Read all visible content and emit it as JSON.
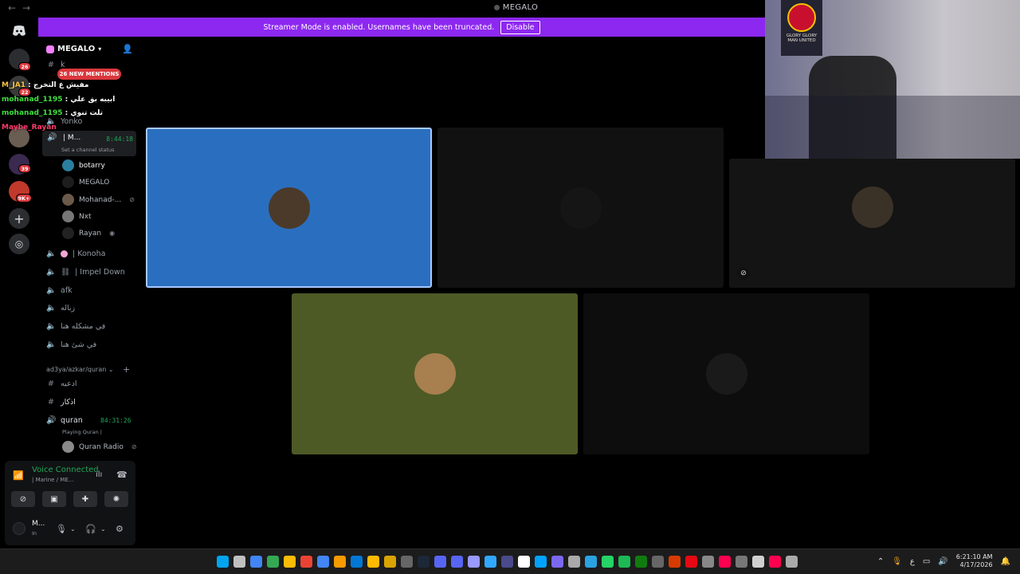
{
  "window": {
    "title": "MEGALO",
    "back": "←",
    "forward": "→"
  },
  "banner": {
    "text": "Streamer Mode is enabled. Usernames have been truncated.",
    "button": "Disable"
  },
  "guilds": {
    "badges": [
      "26",
      "22",
      "39",
      "9K+"
    ]
  },
  "server": {
    "name": "MEGALO",
    "mentions_pill": "26 NEW MENTIONS"
  },
  "channels": {
    "top_text": "k",
    "yonko": "Yonko",
    "active": {
      "name": "| M...",
      "timer": "8:44:18",
      "status": "Set a channel status"
    },
    "members": [
      {
        "name": "botarry",
        "color": "#2a7fa0"
      },
      {
        "name": "MEGALO",
        "color": "#1d1d1d"
      },
      {
        "name": "Mohanad-...",
        "color": "#6b5a4a"
      },
      {
        "name": "Nxt",
        "color": "#777"
      },
      {
        "name": "Rayan",
        "color": "#222"
      }
    ],
    "voice": [
      "| Konoha",
      "| Impel Down",
      "afk",
      "زباله",
      "في مشكله هنا",
      "في شئ هنا"
    ],
    "category": "ad3ya/azkar/quran",
    "text2": [
      "ادعيه",
      "اذكار"
    ],
    "quran": {
      "name": "quran",
      "timer": "84:31:26",
      "status": "Playing Quran |",
      "member": "Quran Radio"
    }
  },
  "overlay": [
    {
      "user": "M_JA1",
      "msg": "مفيش ع التخرج"
    },
    {
      "user": "mohanad_1195",
      "msg": "ابيبه بق علي"
    },
    {
      "user": "mohanad_1195",
      "msg": "تلت تنوي"
    },
    {
      "user": "Maybe_Rayan",
      "msg": ""
    }
  ],
  "voice_panel": {
    "title": "Voice Connected",
    "subtitle": "| Marine / ME...",
    "user": "M...",
    "user_sub": "In"
  },
  "tiles": [
    {
      "bg": "#2a6fbf",
      "avatar": "#4b3a2a",
      "border": "#8ab4ff"
    },
    {
      "bg": "#111111",
      "avatar": "#151515"
    },
    {
      "bg": "#141414",
      "avatar": "#3a3226",
      "muted": true
    },
    {
      "bg": "#4d5a26",
      "avatar": "#a87f4f"
    },
    {
      "bg": "#0d0d0d",
      "avatar": "#1a1a1a"
    }
  ],
  "webcam": {
    "poster_text": "GLORY GLORY MAN UNITED"
  },
  "taskbar": {
    "icon_colors": [
      "#00a4ef",
      "#c0c0c0",
      "#4285f4",
      "#34a853",
      "#fbbc05",
      "#ea4335",
      "#4285f4",
      "#f59b00",
      "#0078d4",
      "#ffb900",
      "#d9a400",
      "#666",
      "#1b2838",
      "#5865f2",
      "#5865f2",
      "#9999ff",
      "#31a8ff",
      "#4a4a8c",
      "#ffffff",
      "#00a2ff",
      "#7b68ee",
      "#aaaaaa",
      "#2aa3e3",
      "#25d366",
      "#1db954",
      "#107c10",
      "#666",
      "#d83b01",
      "#e50914",
      "#888",
      "#ff0050",
      "#777",
      "#d0d0d0",
      "#ff0050",
      "#aaaaaa"
    ],
    "time": "6:21:10 AM",
    "date": "4/17/2026",
    "lang": "ع"
  }
}
